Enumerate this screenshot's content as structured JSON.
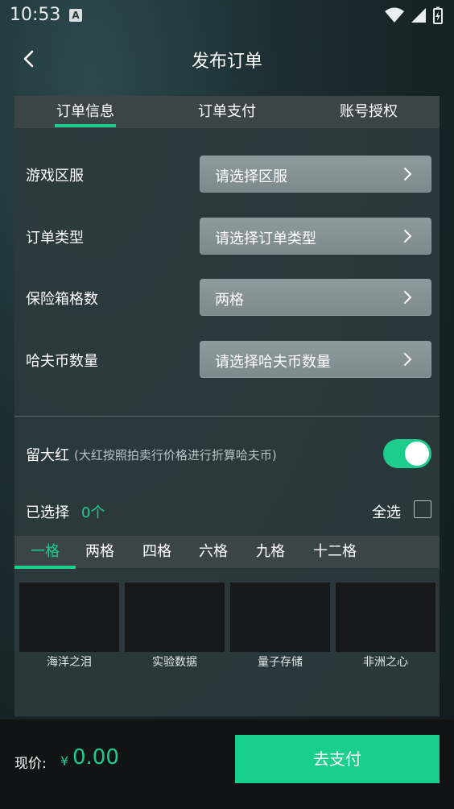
{
  "status_bar": {
    "time": "10:53",
    "sim_badge": "A"
  },
  "header": {
    "title": "发布订单",
    "back_icon": "chevron-left-icon"
  },
  "tabs": [
    {
      "label": "订单信息",
      "active": true
    },
    {
      "label": "订单支付",
      "active": false
    },
    {
      "label": "账号授权",
      "active": false
    }
  ],
  "form": [
    {
      "label": "游戏区服",
      "value": "请选择区服"
    },
    {
      "label": "订单类型",
      "value": "请选择订单类型"
    },
    {
      "label": "保险箱格数",
      "value": "两格"
    },
    {
      "label": "哈夫币数量",
      "value": "请选择哈夫币数量"
    }
  ],
  "liudahong": {
    "label": "留大红",
    "note": "(大红按照拍卖行价格进行折算哈夫币)",
    "enabled": true
  },
  "selection": {
    "label": "已选择",
    "count": "0个",
    "select_all_label": "全选"
  },
  "grid_tabs": [
    {
      "label": "一格",
      "active": true
    },
    {
      "label": "两格",
      "active": false
    },
    {
      "label": "四格",
      "active": false
    },
    {
      "label": "六格",
      "active": false
    },
    {
      "label": "九格",
      "active": false
    },
    {
      "label": "十二格",
      "active": false
    }
  ],
  "items": [
    {
      "name": "海洋之泪"
    },
    {
      "name": "实验数据"
    },
    {
      "name": "量子存储"
    },
    {
      "name": "非洲之心"
    }
  ],
  "footer": {
    "price_label": "现价:",
    "currency": "¥",
    "price": "0.00",
    "pay_label": "去支付"
  },
  "colors": {
    "accent": "#1ccd8d",
    "card_bg": "#2c393e",
    "tab_bg": "#3b4548"
  }
}
